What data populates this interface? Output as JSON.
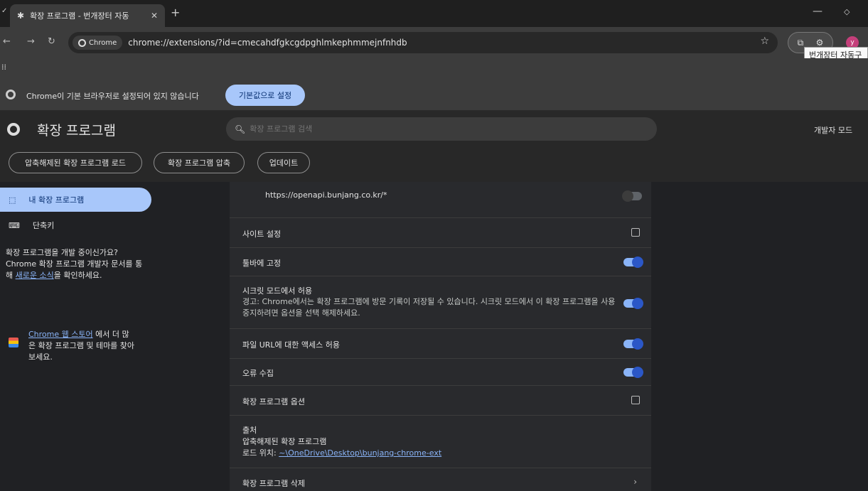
{
  "browser": {
    "tab_title": "확장 프로그램 - 번개장터 자동",
    "url_chip": "Chrome",
    "url": "chrome://extensions/?id=cmecahdfgkcgdpghlmkephmmejnfnhdb",
    "tooltip": "번개장터 자동구",
    "avatar_letter": "y"
  },
  "infobar": {
    "message": "Chrome이 기본 브라우저로 설정되어 있지 않습니다",
    "button": "기본값으로 설정"
  },
  "header": {
    "title": "확장 프로그램",
    "search_placeholder": "확장 프로그램 검색",
    "dev_mode": "개발자 모드",
    "actions": [
      "압축해제된 확장 프로그램 로드",
      "확장 프로그램 압축",
      "업데이트"
    ]
  },
  "sidebar": {
    "items": [
      {
        "label": "내 확장 프로그램"
      },
      {
        "label": "단축키"
      }
    ],
    "promo_text_1": "확장 프로그램을 개발 중이신가요? Chrome 확장 프로그램 개발자 문서를 통해 ",
    "promo_link": "새로운 소식",
    "promo_text_2": "을 확인하세요.",
    "store_link": "Chrome 웹 스토어",
    "store_text": " 에서 더 많은 확장 프로그램 및 테마를 찾아보세요."
  },
  "details": {
    "site_access_url": "https://openapi.bunjang.co.kr/*",
    "site_settings": "사이트 설정",
    "pin_toolbar": "툴바에 고정",
    "incognito_title": "시크릿 모드에서 허용",
    "incognito_warning": "경고: Chrome에서는 확장 프로그램에 방문 기록이 저장될 수 있습니다. 시크릿 모드에서 이 확장 프로그램을 사용 중지하려면 옵션을 선택 해제하세요.",
    "file_url": "파일 URL에 대한 액세스 허용",
    "error_collect": "오류 수집",
    "ext_options": "확장 프로그램 옵션",
    "source_title": "출처",
    "source_value": "압축해제된 확장 프로그램",
    "load_location_label": "로드 위치: ",
    "load_location_path": "~\\OneDrive\\Desktop\\bunjang-chrome-ext",
    "remove": "확장 프로그램 삭제"
  }
}
